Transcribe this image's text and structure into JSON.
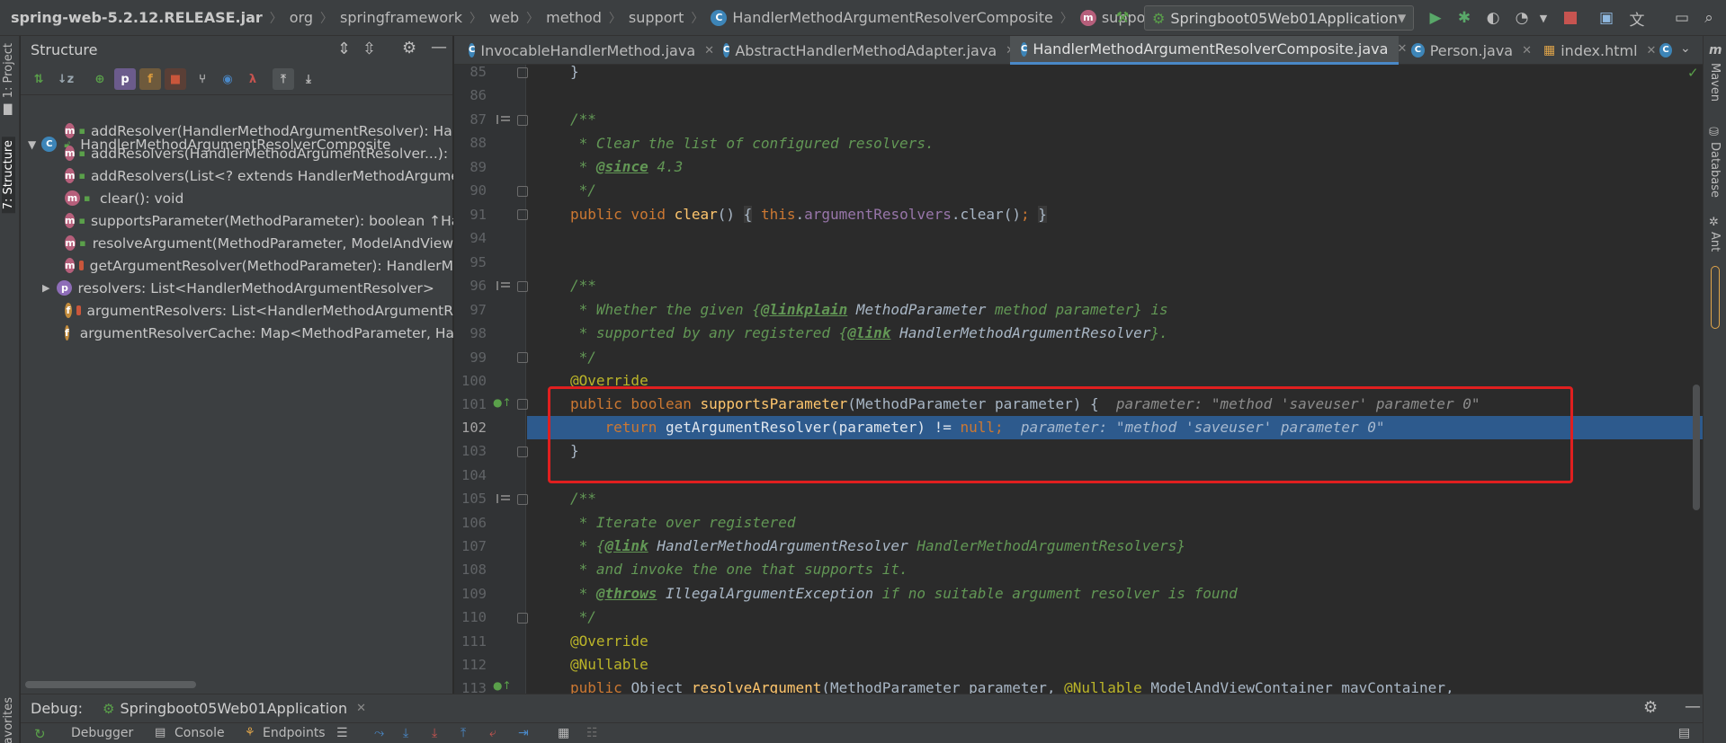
{
  "breadcrumb": {
    "items": [
      "spring-web-5.2.12.RELEASE.jar",
      "org",
      "springframework",
      "web",
      "method",
      "support",
      "HandlerMethodArgumentResolverComposite",
      "supportsParameter"
    ]
  },
  "run_config": {
    "label": "Springboot05Web01Application"
  },
  "left_strip": {
    "project_tab": "1: Project",
    "structure_tab": "7: Structure",
    "favorites_tab": "Favorites"
  },
  "right_strip": {
    "maven": "Maven",
    "database": "Database",
    "ant": "Ant"
  },
  "structure": {
    "title": "Structure",
    "root": "HandlerMethodArgumentResolverComposite",
    "items": [
      {
        "badge": "m",
        "vis": "open",
        "text": "addResolver(HandlerMethodArgumentResolver): Har"
      },
      {
        "badge": "m",
        "vis": "open",
        "text": "addResolvers(HandlerMethodArgumentResolver...): H"
      },
      {
        "badge": "m",
        "vis": "open",
        "text": "addResolvers(List<? extends HandlerMethodArgume"
      },
      {
        "badge": "m",
        "vis": "open",
        "text": "clear(): void"
      },
      {
        "badge": "m",
        "vis": "open",
        "text": "supportsParameter(MethodParameter): boolean ↑Han"
      },
      {
        "badge": "m",
        "vis": "open",
        "text": "resolveArgument(MethodParameter, ModelAndView"
      },
      {
        "badge": "m",
        "vis": "lock",
        "text": "getArgumentResolver(MethodParameter): HandlerM"
      },
      {
        "badge": "p",
        "vis": "none",
        "text": "resolvers: List<HandlerMethodArgumentResolver>"
      },
      {
        "badge": "f",
        "vis": "lock",
        "text": "argumentResolvers: List<HandlerMethodArgumentR"
      },
      {
        "badge": "f",
        "vis": "lock",
        "text": "argumentResolverCache: Map<MethodParameter, Ha"
      }
    ]
  },
  "tabs": [
    {
      "label": "InvocableHandlerMethod.java",
      "active": false
    },
    {
      "label": "AbstractHandlerMethodAdapter.java",
      "active": false
    },
    {
      "label": "HandlerMethodArgumentResolverComposite.java",
      "active": true
    },
    {
      "label": "Person.java",
      "active": false
    },
    {
      "label": "index.html",
      "active": false
    }
  ],
  "editor": {
    "line_numbers": [
      "85",
      "86",
      "87",
      "88",
      "89",
      "90",
      "91",
      "94",
      "95",
      "96",
      "97",
      "98",
      "99",
      "100",
      "101",
      "102",
      "103",
      "104",
      "105",
      "106",
      "107",
      "108",
      "109",
      "110",
      "111",
      "112",
      "113"
    ],
    "hint_parameter": "parameter: \"method 'saveuser' parameter 0\""
  },
  "debug": {
    "label": "Debug:",
    "session": "Springboot05Web01Application",
    "tabs": [
      "Debugger",
      "Console",
      "Endpoints"
    ]
  },
  "colors": {
    "execution_line": "#2d5a8d",
    "annotation_box": "#e01f1f"
  }
}
